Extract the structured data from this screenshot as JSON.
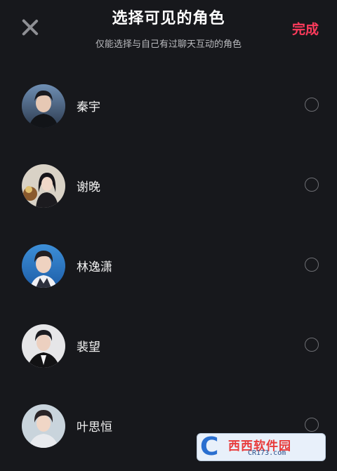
{
  "header": {
    "title": "选择可见的角色",
    "subtitle": "仅能选择与自己有过聊天互动的角色",
    "done_label": "完成"
  },
  "characters": [
    {
      "name": "秦宇",
      "selected": false
    },
    {
      "name": "谢晚",
      "selected": false
    },
    {
      "name": "林逸潇",
      "selected": false
    },
    {
      "name": "裴望",
      "selected": false
    },
    {
      "name": "叶思恒",
      "selected": false
    }
  ],
  "watermark": {
    "text": "西西软件园",
    "url": "CR173.com"
  },
  "colors": {
    "background": "#17181c",
    "accent": "#ff3b5c",
    "text": "#ffffff",
    "subtext": "#b9babe",
    "radio_border": "#6d6e73"
  }
}
